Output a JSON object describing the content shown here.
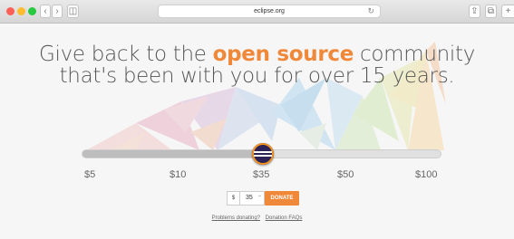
{
  "browser": {
    "url": "eclipse.org",
    "reload_icon": "reload-icon",
    "back_glyph": "‹",
    "forward_glyph": "›",
    "sidebar_glyph": "◫",
    "share_glyph": "⇪",
    "tabs_glyph": "⧉",
    "newtab_glyph": "+"
  },
  "headline": {
    "line1_prefix": "Give back to the ",
    "line1_highlight": "open source",
    "line1_suffix": " community",
    "line2": "that's been with you for over 15 years."
  },
  "slider": {
    "amounts": [
      "$5",
      "$10",
      "$35",
      "$50",
      "$100"
    ],
    "selected_value_fraction": 0.5
  },
  "donation": {
    "currency": "$",
    "amount": "35",
    "spinner_glyph": "⌃",
    "button_label": "DONATE"
  },
  "links": {
    "problems": "Problems donating?",
    "faqs": "Donation FAQs"
  },
  "colors": {
    "accent": "#f0883a",
    "handle": "#2c2255"
  }
}
